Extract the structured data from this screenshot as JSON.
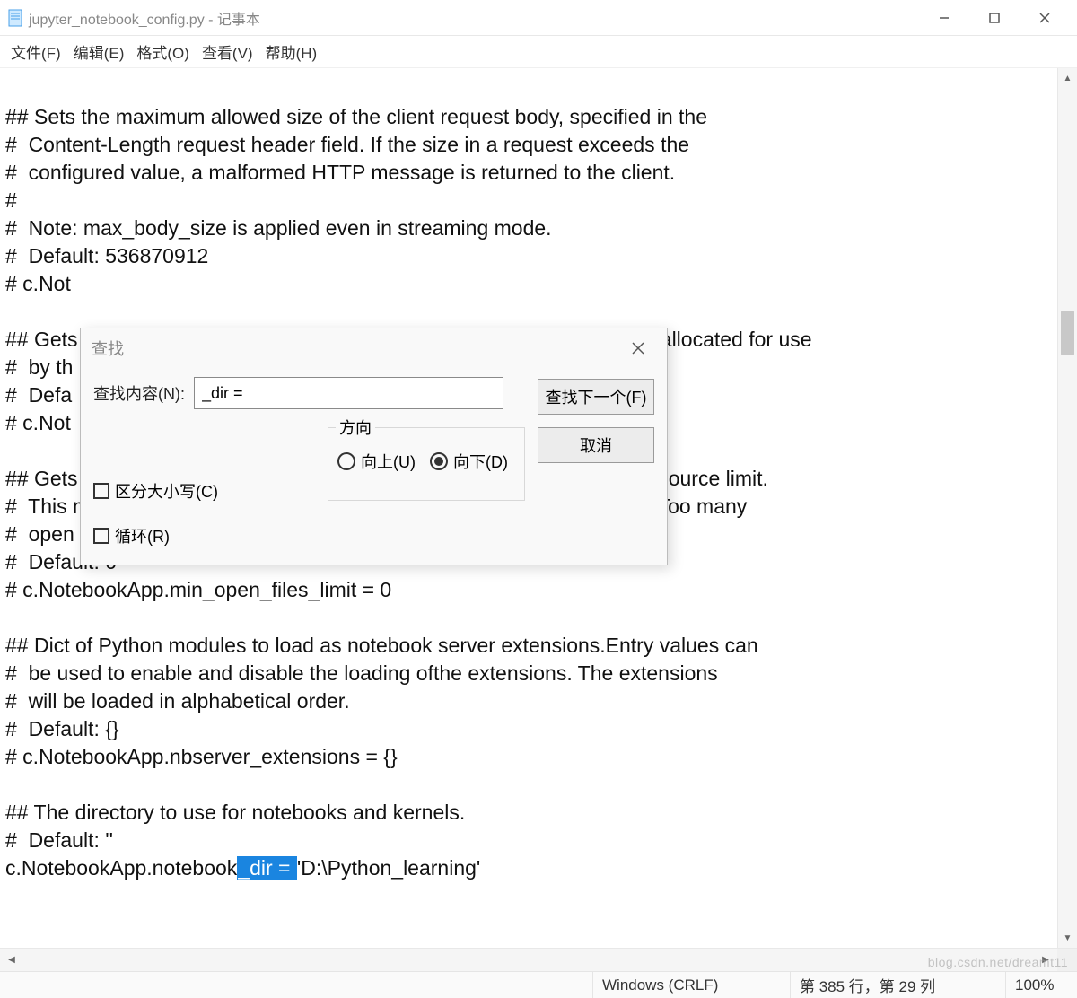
{
  "titlebar": {
    "filename": "jupyter_notebook_config.py",
    "separator": " - ",
    "appname": "记事本"
  },
  "menubar": {
    "file": "文件(F)",
    "edit": "编辑(E)",
    "format": "格式(O)",
    "view": "查看(V)",
    "help": "帮助(H)"
  },
  "editor": {
    "pre_text": "\n## Sets the maximum allowed size of the client request body, specified in the\n#  Content-Length request header field. If the size in a request exceeds the\n#  configured value, a malformed HTTP message is returned to the client.\n#\n#  Note: max_body_size is applied even in streaming mode.\n#  Default: 536870912\n# c.Not\n\n## Gets                                                                                                  is allocated for use\n#  by th\n#  Defa\n# c.Not\n\n## Gets                                                                                                  resource limit.\n#  This may need to be increased if you run into an OSError: [Errno 24] Too many\n#  open files. This is not applicable when running on Windows.\n#  Default: 0\n# c.NotebookApp.min_open_files_limit = 0\n\n## Dict of Python modules to load as notebook server extensions.Entry values can\n#  be used to enable and disable the loading ofthe extensions. The extensions\n#  will be loaded in alphabetical order.\n#  Default: {}\n# c.NotebookApp.nbserver_extensions = {}\n\n## The directory to use for notebooks and kernels.\n#  Default: ''",
    "last_line_prefix": "c.NotebookApp.notebook",
    "highlight": "_dir = ",
    "last_line_suffix": "'D:\\Python_learning'"
  },
  "find": {
    "title": "查找",
    "content_label": "查找内容(N):",
    "content_value": "_dir =",
    "direction_label": "方向",
    "up_label": "向上(U)",
    "down_label": "向下(D)",
    "down_checked": true,
    "case_label": "区分大小写(C)",
    "wrap_label": "循环(R)",
    "find_next": "查找下一个(F)",
    "cancel": "取消"
  },
  "statusbar": {
    "encoding_hint": "Windows (CRLF)",
    "position": "第 385 行，第 29 列",
    "zoom": "100%"
  },
  "watermark": "blog.csdn.net/dreamt11"
}
